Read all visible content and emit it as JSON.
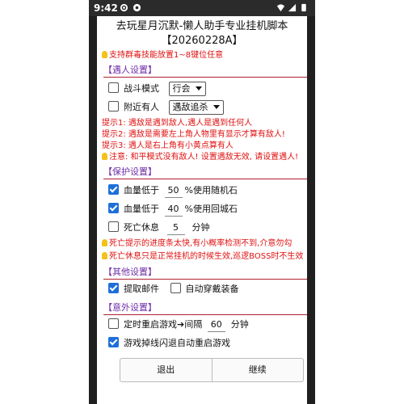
{
  "status": {
    "time": "9:42"
  },
  "header": {
    "title": "去玩星月沉默-懒人助手专业挂机脚本",
    "version": "【20260228A】",
    "tip": "支持群毒技能放置1~8键位任意"
  },
  "sections": {
    "encounter": "【遇人设置】",
    "protect": "【保护设置】",
    "other": "【其他设置】",
    "accident": "【意外设置】"
  },
  "encounter": {
    "battle_mode_label": "战斗模式",
    "battle_mode_value": "行会",
    "nearby_label": "附近有人",
    "nearby_value": "遇敌追杀",
    "hint1": "提示1: 遇敌是遇到敌人,遇人是遇到任何人",
    "hint2": "提示2: 遇敌是需要左上角人物里有显示才算有敌人!",
    "hint3": "提示3: 遇人是右上角有小黄点算有人",
    "note": "注意: 和平模式没有敌人! 设置遇敌无效, 请设置遇人!"
  },
  "protect": {
    "hp1_label": "血量低于",
    "hp1_value": "50",
    "hp1_suffix": "%使用随机石",
    "hp2_label": "血量低于",
    "hp2_value": "40",
    "hp2_suffix": "%使用回城石",
    "death_label": "死亡休息",
    "death_value": "5",
    "death_suffix": "分钟",
    "tip1": "死亡提示的进度条太快,有小概率检测不到,介意勿勾",
    "tip2": "死亡休息只是正常挂机的时候生效,巡逻BOSS时不生效"
  },
  "other": {
    "mail_label": "提取邮件",
    "equip_label": "自动穿戴装备"
  },
  "accident": {
    "restart_label": "定时重启游戏",
    "arrow": "➔",
    "interval_label": "间隔",
    "interval_value": "60",
    "interval_suffix": "分钟",
    "crash_label": "游戏掉线闪退自动重启游戏"
  },
  "buttons": {
    "exit": "退出",
    "continue": "继续"
  },
  "colors": {
    "accent": "#1e6fd9",
    "section_title": "#6f2ca8",
    "hint_red": "#e01010",
    "status_bar": "#2b2b2b"
  }
}
